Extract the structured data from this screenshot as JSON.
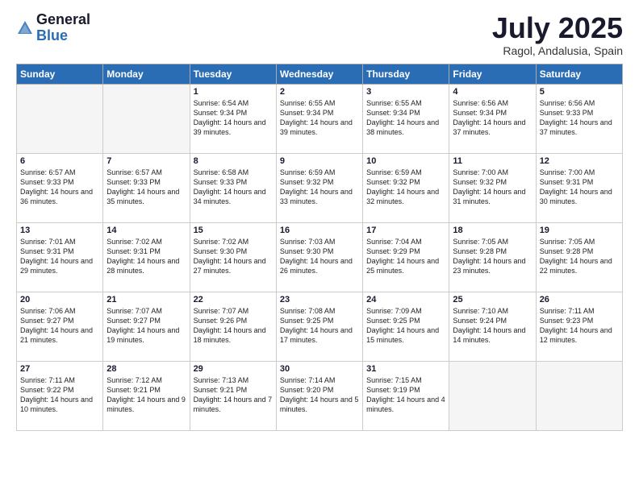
{
  "header": {
    "logo_general": "General",
    "logo_blue": "Blue",
    "month_title": "July 2025",
    "location": "Ragol, Andalusia, Spain"
  },
  "weekdays": [
    "Sunday",
    "Monday",
    "Tuesday",
    "Wednesday",
    "Thursday",
    "Friday",
    "Saturday"
  ],
  "weeks": [
    [
      {
        "day": "",
        "empty": true
      },
      {
        "day": "",
        "empty": true
      },
      {
        "day": "1",
        "sunrise": "6:54 AM",
        "sunset": "9:34 PM",
        "daylight": "14 hours and 39 minutes."
      },
      {
        "day": "2",
        "sunrise": "6:55 AM",
        "sunset": "9:34 PM",
        "daylight": "14 hours and 39 minutes."
      },
      {
        "day": "3",
        "sunrise": "6:55 AM",
        "sunset": "9:34 PM",
        "daylight": "14 hours and 38 minutes."
      },
      {
        "day": "4",
        "sunrise": "6:56 AM",
        "sunset": "9:34 PM",
        "daylight": "14 hours and 37 minutes."
      },
      {
        "day": "5",
        "sunrise": "6:56 AM",
        "sunset": "9:33 PM",
        "daylight": "14 hours and 37 minutes."
      }
    ],
    [
      {
        "day": "6",
        "sunrise": "6:57 AM",
        "sunset": "9:33 PM",
        "daylight": "14 hours and 36 minutes."
      },
      {
        "day": "7",
        "sunrise": "6:57 AM",
        "sunset": "9:33 PM",
        "daylight": "14 hours and 35 minutes."
      },
      {
        "day": "8",
        "sunrise": "6:58 AM",
        "sunset": "9:33 PM",
        "daylight": "14 hours and 34 minutes."
      },
      {
        "day": "9",
        "sunrise": "6:59 AM",
        "sunset": "9:32 PM",
        "daylight": "14 hours and 33 minutes."
      },
      {
        "day": "10",
        "sunrise": "6:59 AM",
        "sunset": "9:32 PM",
        "daylight": "14 hours and 32 minutes."
      },
      {
        "day": "11",
        "sunrise": "7:00 AM",
        "sunset": "9:32 PM",
        "daylight": "14 hours and 31 minutes."
      },
      {
        "day": "12",
        "sunrise": "7:00 AM",
        "sunset": "9:31 PM",
        "daylight": "14 hours and 30 minutes."
      }
    ],
    [
      {
        "day": "13",
        "sunrise": "7:01 AM",
        "sunset": "9:31 PM",
        "daylight": "14 hours and 29 minutes."
      },
      {
        "day": "14",
        "sunrise": "7:02 AM",
        "sunset": "9:31 PM",
        "daylight": "14 hours and 28 minutes."
      },
      {
        "day": "15",
        "sunrise": "7:02 AM",
        "sunset": "9:30 PM",
        "daylight": "14 hours and 27 minutes."
      },
      {
        "day": "16",
        "sunrise": "7:03 AM",
        "sunset": "9:30 PM",
        "daylight": "14 hours and 26 minutes."
      },
      {
        "day": "17",
        "sunrise": "7:04 AM",
        "sunset": "9:29 PM",
        "daylight": "14 hours and 25 minutes."
      },
      {
        "day": "18",
        "sunrise": "7:05 AM",
        "sunset": "9:28 PM",
        "daylight": "14 hours and 23 minutes."
      },
      {
        "day": "19",
        "sunrise": "7:05 AM",
        "sunset": "9:28 PM",
        "daylight": "14 hours and 22 minutes."
      }
    ],
    [
      {
        "day": "20",
        "sunrise": "7:06 AM",
        "sunset": "9:27 PM",
        "daylight": "14 hours and 21 minutes."
      },
      {
        "day": "21",
        "sunrise": "7:07 AM",
        "sunset": "9:27 PM",
        "daylight": "14 hours and 19 minutes."
      },
      {
        "day": "22",
        "sunrise": "7:07 AM",
        "sunset": "9:26 PM",
        "daylight": "14 hours and 18 minutes."
      },
      {
        "day": "23",
        "sunrise": "7:08 AM",
        "sunset": "9:25 PM",
        "daylight": "14 hours and 17 minutes."
      },
      {
        "day": "24",
        "sunrise": "7:09 AM",
        "sunset": "9:25 PM",
        "daylight": "14 hours and 15 minutes."
      },
      {
        "day": "25",
        "sunrise": "7:10 AM",
        "sunset": "9:24 PM",
        "daylight": "14 hours and 14 minutes."
      },
      {
        "day": "26",
        "sunrise": "7:11 AM",
        "sunset": "9:23 PM",
        "daylight": "14 hours and 12 minutes."
      }
    ],
    [
      {
        "day": "27",
        "sunrise": "7:11 AM",
        "sunset": "9:22 PM",
        "daylight": "14 hours and 10 minutes."
      },
      {
        "day": "28",
        "sunrise": "7:12 AM",
        "sunset": "9:21 PM",
        "daylight": "14 hours and 9 minutes."
      },
      {
        "day": "29",
        "sunrise": "7:13 AM",
        "sunset": "9:21 PM",
        "daylight": "14 hours and 7 minutes."
      },
      {
        "day": "30",
        "sunrise": "7:14 AM",
        "sunset": "9:20 PM",
        "daylight": "14 hours and 5 minutes."
      },
      {
        "day": "31",
        "sunrise": "7:15 AM",
        "sunset": "9:19 PM",
        "daylight": "14 hours and 4 minutes."
      },
      {
        "day": "",
        "empty": true
      },
      {
        "day": "",
        "empty": true
      }
    ]
  ]
}
